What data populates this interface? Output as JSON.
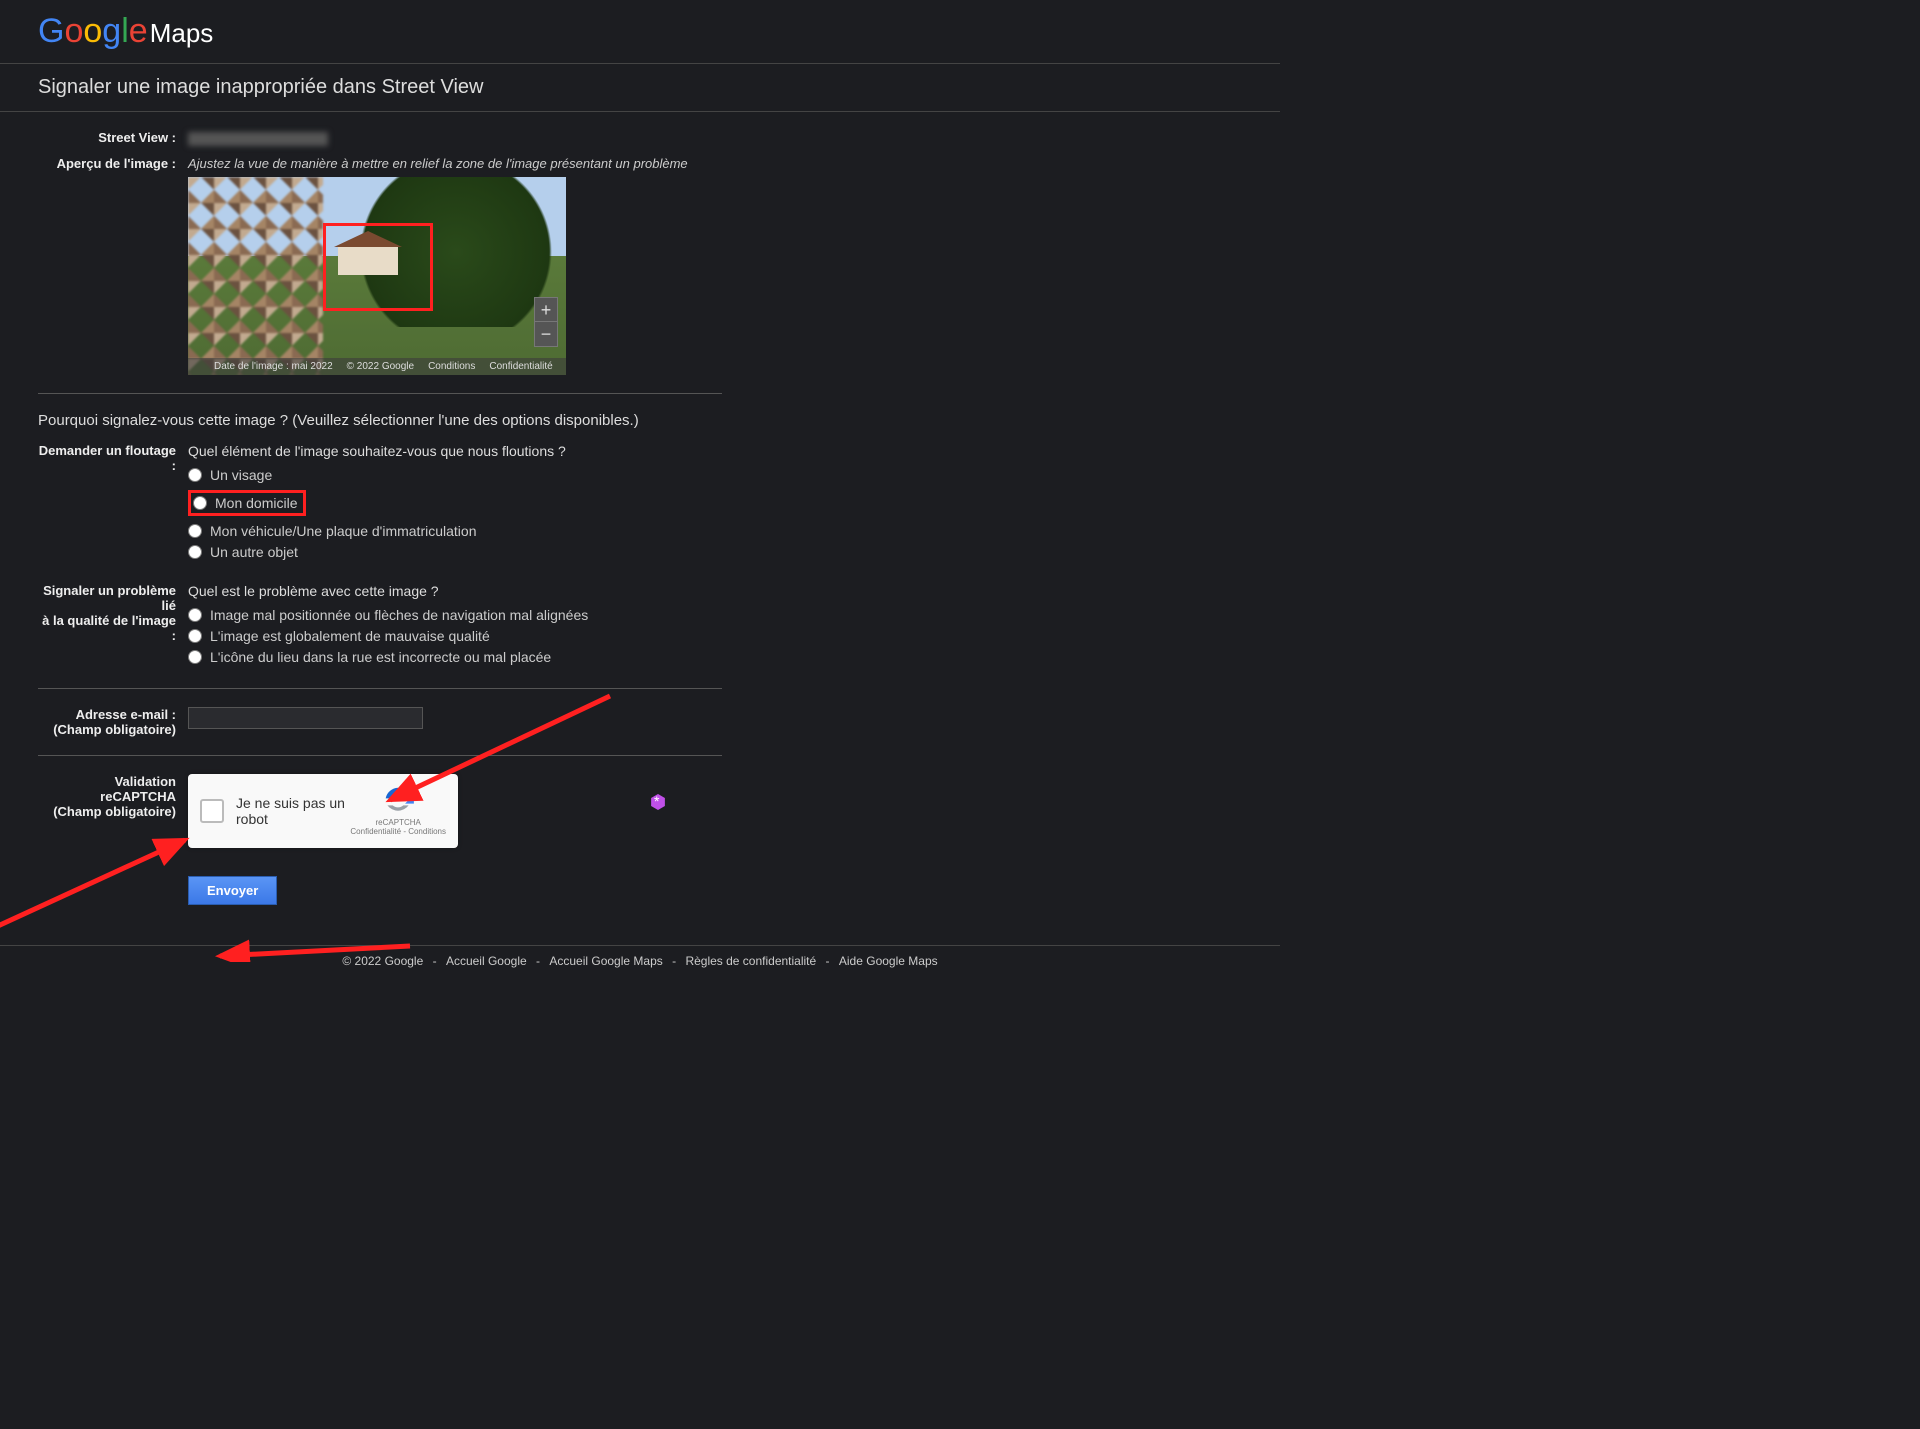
{
  "logo": {
    "maps": "Maps"
  },
  "page_title": "Signaler une image inappropriée dans Street View",
  "fields": {
    "street_view_label": "Street View :",
    "preview_label": "Aperçu de l'image :",
    "preview_hint": "Ajustez la vue de manière à mettre en relief la zone de l'image présentant un problème",
    "image_date": "Date de l'image : mai 2022",
    "copyright": "© 2022 Google",
    "conditions": "Conditions",
    "confidentialite": "Confidentialité"
  },
  "question": "Pourquoi signalez-vous cette image ?  (Veuillez sélectionner l'une des options disponibles.)",
  "blur": {
    "label": "Demander un floutage :",
    "question": "Quel élément de l'image souhaitez-vous que nous floutions ?",
    "opts": [
      "Un visage",
      "Mon domicile",
      "Mon véhicule/Une plaque d'immatriculation",
      "Un autre objet"
    ]
  },
  "quality": {
    "label_line1": "Signaler un problème lié",
    "label_line2": "à la qualité de l'image :",
    "question": "Quel est le problème avec cette image ?",
    "opts": [
      "Image mal positionnée ou flèches de navigation mal alignées",
      "L'image est globalement de mauvaise qualité",
      "L'icône du lieu dans la rue est incorrecte ou mal placée"
    ]
  },
  "email": {
    "label_line1": "Adresse e-mail :",
    "label_line2": "(Champ obligatoire)"
  },
  "captcha": {
    "label_line1": "Validation reCAPTCHA",
    "label_line2": "(Champ obligatoire)",
    "checkbox_label": "Je ne suis pas un robot",
    "brand": "reCAPTCHA",
    "legal": "Confidentialité - Conditions"
  },
  "submit": "Envoyer",
  "footer": {
    "copyright": "© 2022 Google",
    "links": [
      "Accueil Google",
      "Accueil Google Maps",
      "Règles de confidentialité",
      "Aide Google Maps"
    ]
  }
}
